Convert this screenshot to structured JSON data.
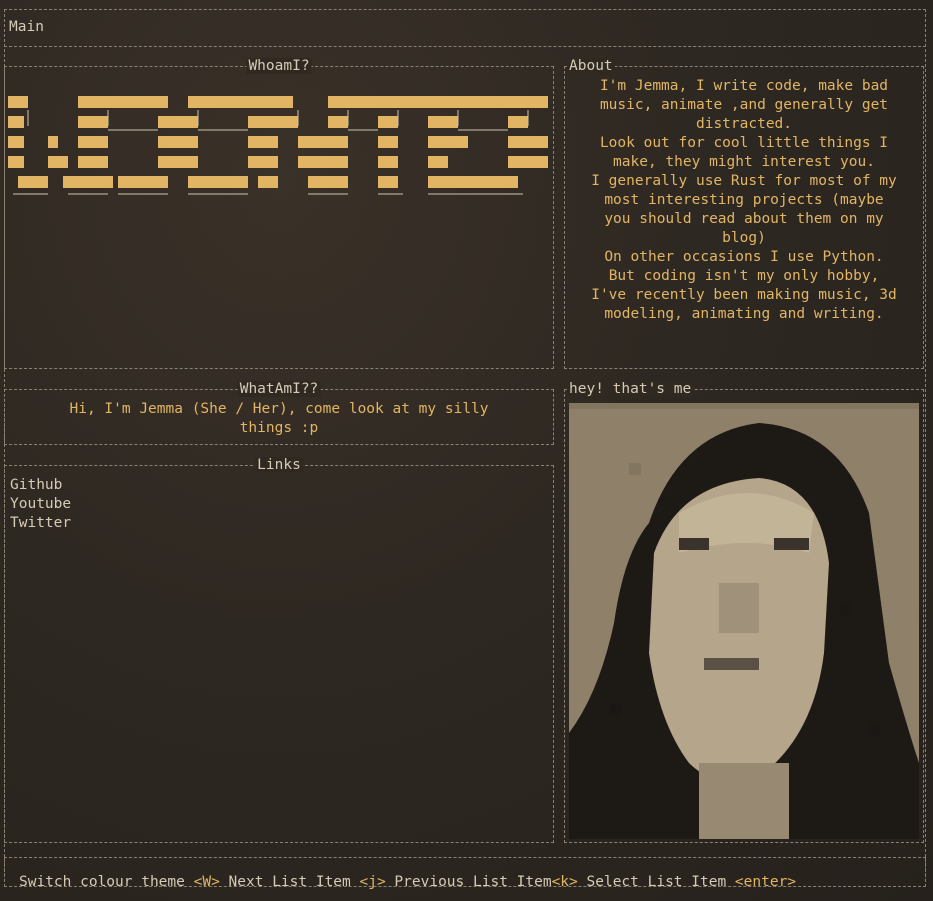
{
  "main": {
    "title": "Main"
  },
  "whoami": {
    "title": "WhoamI?",
    "banner_alt": "Jemma"
  },
  "about": {
    "title": "About",
    "lines": [
      "I'm Jemma, I write code, make bad",
      "music, animate ,and generally get",
      "distracted.",
      "Look out for cool little things I",
      "make, they might interest you.",
      "I generally use Rust for most of my",
      "most interesting projects (maybe",
      "you should read about them on my",
      "blog)",
      "On other occasions I use Python.",
      "But coding isn't my only hobby,",
      "I've recently been making music, 3d",
      "modeling, animating and writing."
    ]
  },
  "whatami": {
    "title": "WhatAmI??",
    "line1": "Hi, I'm Jemma (She / Her), come look at my silly",
    "line2": "things :p"
  },
  "links": {
    "title": "Links",
    "items": [
      "Github",
      "Youtube",
      "Twitter"
    ]
  },
  "photo": {
    "title": "hey! that's me"
  },
  "footer": {
    "switch_label": "Switch colour theme ",
    "switch_key": "<W>",
    "next_label": " Next List Item ",
    "next_key": "<j>",
    "prev_label": " Previous List Item",
    "prev_key": "<k>",
    "select_label": " Select List Item ",
    "select_key": "<enter>"
  },
  "colors": {
    "accent": "#e2b564",
    "text": "#d6cbb5",
    "border": "#8a8170",
    "background": "#2e2822"
  }
}
